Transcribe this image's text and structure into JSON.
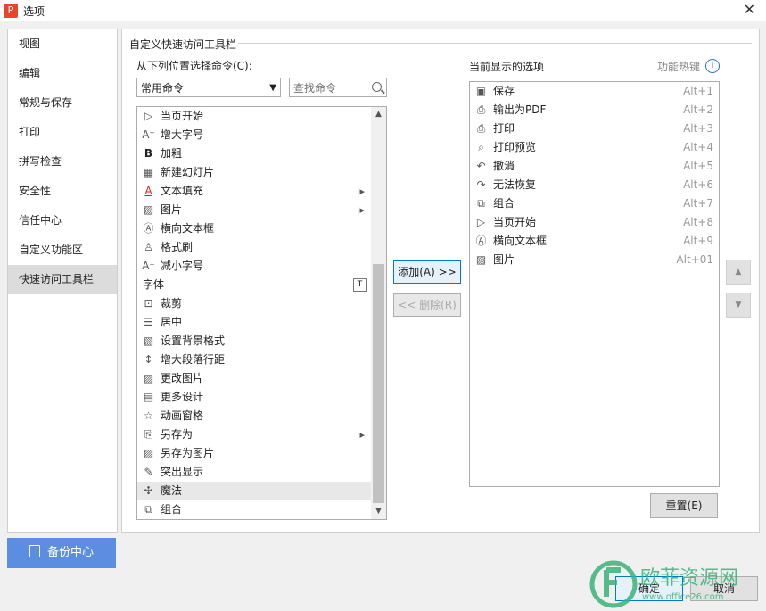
{
  "window": {
    "title": "选项",
    "app_icon_glyph": "P",
    "close_glyph": "✕"
  },
  "sidebar": {
    "items": [
      {
        "label": "视图"
      },
      {
        "label": "编辑"
      },
      {
        "label": "常规与保存"
      },
      {
        "label": "打印"
      },
      {
        "label": "拼写检查"
      },
      {
        "label": "安全性"
      },
      {
        "label": "信任中心"
      },
      {
        "label": "自定义功能区"
      },
      {
        "label": "快速访问工具栏",
        "selected": true
      }
    ],
    "backup_label": "备份中心"
  },
  "section_title": "自定义快速访问工具栏",
  "left": {
    "from_label": "从下列位置选择命令(C):",
    "combo_value": "常用命令",
    "search_placeholder": "查找命令",
    "items": [
      {
        "label": "当页开始",
        "icon": "play-circle-icon",
        "glyph": "▷"
      },
      {
        "label": "增大字号",
        "icon": "font-increase-icon",
        "glyph": "A⁺"
      },
      {
        "label": "加粗",
        "icon": "bold-icon",
        "glyph": "B"
      },
      {
        "label": "新建幻灯片",
        "icon": "new-slide-icon",
        "glyph": "▦"
      },
      {
        "label": "文本填充",
        "icon": "text-fill-icon",
        "glyph": "A",
        "submenu": true
      },
      {
        "label": "图片",
        "icon": "picture-icon",
        "glyph": "▨",
        "submenu": true
      },
      {
        "label": "横向文本框",
        "icon": "textbox-icon",
        "glyph": "Ⓐ"
      },
      {
        "label": "格式刷",
        "icon": "format-painter-icon",
        "glyph": "♙"
      },
      {
        "label": "减小字号",
        "icon": "font-decrease-icon",
        "glyph": "A⁻"
      },
      {
        "label": "字体",
        "group": true
      },
      {
        "label": "裁剪",
        "icon": "crop-icon",
        "glyph": "⊡"
      },
      {
        "label": "居中",
        "icon": "align-center-icon",
        "glyph": "☰"
      },
      {
        "label": "设置背景格式",
        "icon": "background-format-icon",
        "glyph": "▧"
      },
      {
        "label": "增大段落行距",
        "icon": "line-spacing-icon",
        "glyph": "↕"
      },
      {
        "label": "更改图片",
        "icon": "change-picture-icon",
        "glyph": "▨"
      },
      {
        "label": "更多设计",
        "icon": "more-design-icon",
        "glyph": "▤"
      },
      {
        "label": "动画窗格",
        "icon": "animation-pane-icon",
        "glyph": "☆"
      },
      {
        "label": "另存为",
        "icon": "save-as-icon",
        "glyph": "⎘",
        "submenu": true
      },
      {
        "label": "另存为图片",
        "icon": "save-as-picture-icon",
        "glyph": "▨"
      },
      {
        "label": "突出显示",
        "icon": "highlight-icon",
        "glyph": "✎"
      },
      {
        "label": "魔法",
        "icon": "magic-icon",
        "glyph": "✣",
        "selected": true
      },
      {
        "label": "组合",
        "icon": "group-icon",
        "glyph": "⧉"
      }
    ]
  },
  "middle": {
    "add_label": "添加(A) >>",
    "remove_label": "<< 删除(R)"
  },
  "right": {
    "current_label": "当前显示的选项",
    "hotkey_label": "功能热键",
    "info_glyph": "i",
    "items": [
      {
        "label": "保存",
        "key": "Alt+1",
        "icon": "save-icon",
        "glyph": "▣"
      },
      {
        "label": "输出为PDF",
        "key": "Alt+2",
        "icon": "export-pdf-icon",
        "glyph": "⎙"
      },
      {
        "label": "打印",
        "key": "Alt+3",
        "icon": "print-icon",
        "glyph": "⎙"
      },
      {
        "label": "打印预览",
        "key": "Alt+4",
        "icon": "print-preview-icon",
        "glyph": "⌕"
      },
      {
        "label": "撤消",
        "key": "Alt+5",
        "icon": "undo-icon",
        "glyph": "↶"
      },
      {
        "label": "无法恢复",
        "key": "Alt+6",
        "icon": "redo-icon",
        "glyph": "↷"
      },
      {
        "label": "组合",
        "key": "Alt+7",
        "icon": "group-icon",
        "glyph": "⧉"
      },
      {
        "label": "当页开始",
        "key": "Alt+8",
        "icon": "play-circle-icon",
        "glyph": "▷"
      },
      {
        "label": "横向文本框",
        "key": "Alt+9",
        "icon": "textbox-icon",
        "glyph": "Ⓐ"
      },
      {
        "label": "图片",
        "key": "Alt+01",
        "icon": "picture-icon",
        "glyph": "▨"
      }
    ],
    "reset_label": "重置(E)"
  },
  "footer": {
    "ok_label": "确定",
    "cancel_label": "取消"
  },
  "watermark": {
    "text": "欧菲资源网",
    "url": "www.office26.com"
  },
  "colors": {
    "accent": "#5b8de0",
    "focus_border": "#0078d7",
    "text_fill_red": "#d9261c",
    "info_blue": "#2a6fd6"
  }
}
